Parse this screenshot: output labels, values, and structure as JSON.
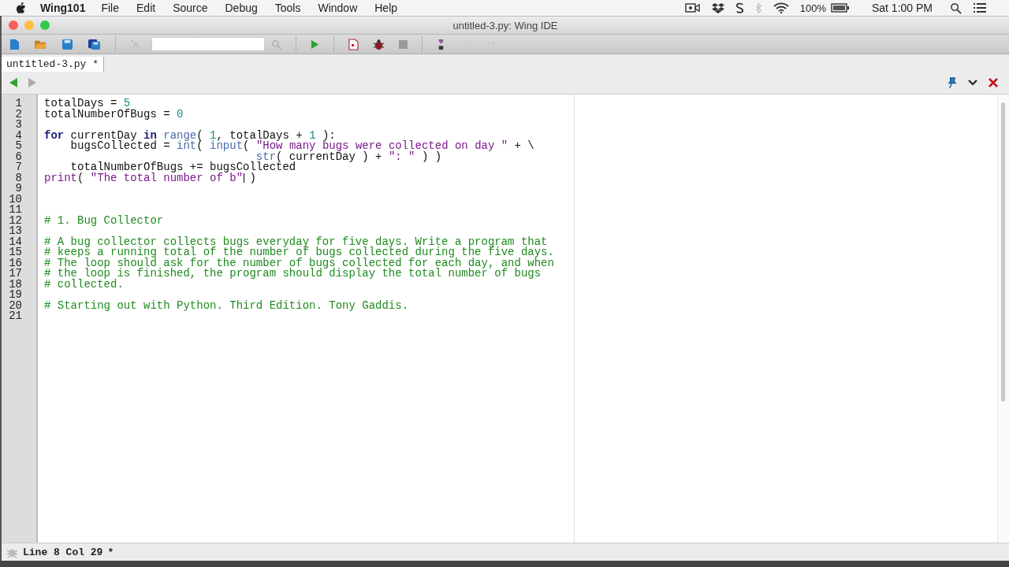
{
  "menu_bar": {
    "app": "Wing101",
    "items": [
      "File",
      "Edit",
      "Source",
      "Debug",
      "Tools",
      "Window",
      "Help"
    ],
    "battery": "100%",
    "clock": "Sat 1:00 PM"
  },
  "window": {
    "title": "untitled-3.py: Wing IDE"
  },
  "tabs": [
    {
      "label": "untitled-3.py *",
      "selected": true
    }
  ],
  "editor": {
    "lines": [
      {
        "number": "1",
        "cursor": false,
        "tokens": [
          {
            "kind": "plain",
            "text": "totalDays = "
          },
          {
            "kind": "number",
            "text": "5"
          }
        ]
      },
      {
        "number": "2",
        "cursor": false,
        "tokens": [
          {
            "kind": "plain",
            "text": "totalNumberOfBugs = "
          },
          {
            "kind": "number",
            "text": "0"
          }
        ]
      },
      {
        "number": "3",
        "cursor": false
      },
      {
        "number": "4",
        "cursor": false,
        "tokens": [
          {
            "kind": "keyword",
            "text": "for"
          },
          {
            "kind": "plain",
            "text": " currentDay "
          },
          {
            "kind": "keyword",
            "text": "in "
          },
          {
            "kind": "builtin",
            "text": "range"
          },
          {
            "kind": "plain",
            "text": "( "
          },
          {
            "kind": "number",
            "text": "1"
          },
          {
            "kind": "plain",
            "text": ", totalDays + "
          },
          {
            "kind": "number",
            "text": "1"
          },
          {
            "kind": "plain",
            "text": " ):"
          }
        ]
      },
      {
        "number": "5",
        "cursor": false,
        "tokens": [
          {
            "kind": "plain",
            "text": "    bugsCollected = "
          },
          {
            "kind": "builtin",
            "text": "int"
          },
          {
            "kind": "plain",
            "text": "( "
          },
          {
            "kind": "builtin",
            "text": "input"
          },
          {
            "kind": "plain",
            "text": "( "
          },
          {
            "kind": "string",
            "text": "\"How many bugs were collected on day \""
          },
          {
            "kind": "plain",
            "text": " + \\"
          }
        ]
      },
      {
        "number": "6",
        "cursor": false,
        "tokens": [
          {
            "kind": "builtin",
            "text": "                                str"
          },
          {
            "kind": "plain",
            "text": "( currentDay ) + "
          },
          {
            "kind": "string",
            "text": "\": \""
          },
          {
            "kind": "plain",
            "text": " ) )"
          }
        ]
      },
      {
        "number": "7",
        "cursor": false,
        "tokens": [
          {
            "kind": "plain",
            "text": "    totalNumberOfBugs += bugsCollected"
          }
        ]
      },
      {
        "number": "8",
        "cursor": true,
        "tokens": [
          {
            "kind": "function",
            "text": "print"
          },
          {
            "kind": "plain",
            "text": "( "
          },
          {
            "kind": "string",
            "text": "\"The total number of b\""
          },
          {
            "kind": "plain",
            "text": " )"
          }
        ]
      },
      {
        "number": "9",
        "cursor": false
      },
      {
        "number": "10",
        "cursor": false
      },
      {
        "number": "11",
        "cursor": false
      },
      {
        "number": "12",
        "cursor": false,
        "tokens": [
          {
            "kind": "comment",
            "text": "# 1. Bug Collector"
          }
        ]
      },
      {
        "number": "13",
        "cursor": false
      },
      {
        "number": "14",
        "cursor": false,
        "tokens": [
          {
            "kind": "comment",
            "text": "# A bug collector collects bugs everyday for five days. Write a program that"
          }
        ]
      },
      {
        "number": "15",
        "cursor": false,
        "tokens": [
          {
            "kind": "comment",
            "text": "# keeps a running total of the number of bugs collected during the five days."
          }
        ]
      },
      {
        "number": "16",
        "cursor": false,
        "tokens": [
          {
            "kind": "comment",
            "text": "# The loop should ask for the number of bugs collected for each day, and when"
          }
        ]
      },
      {
        "number": "17",
        "cursor": false,
        "tokens": [
          {
            "kind": "comment",
            "text": "# the loop is finished, the program should display the total number of bugs"
          }
        ]
      },
      {
        "number": "18",
        "cursor": false,
        "tokens": [
          {
            "kind": "comment",
            "text": "# collected."
          }
        ]
      },
      {
        "number": "19",
        "cursor": false
      },
      {
        "number": "20",
        "cursor": false,
        "tokens": [
          {
            "kind": "comment",
            "text": "# Starting out with Python. Third Edition. Tony Gaddis."
          }
        ]
      },
      {
        "number": "21",
        "cursor": false
      }
    ]
  },
  "status_bar": {
    "position": "Line 8 Col 29",
    "modified": "*"
  }
}
